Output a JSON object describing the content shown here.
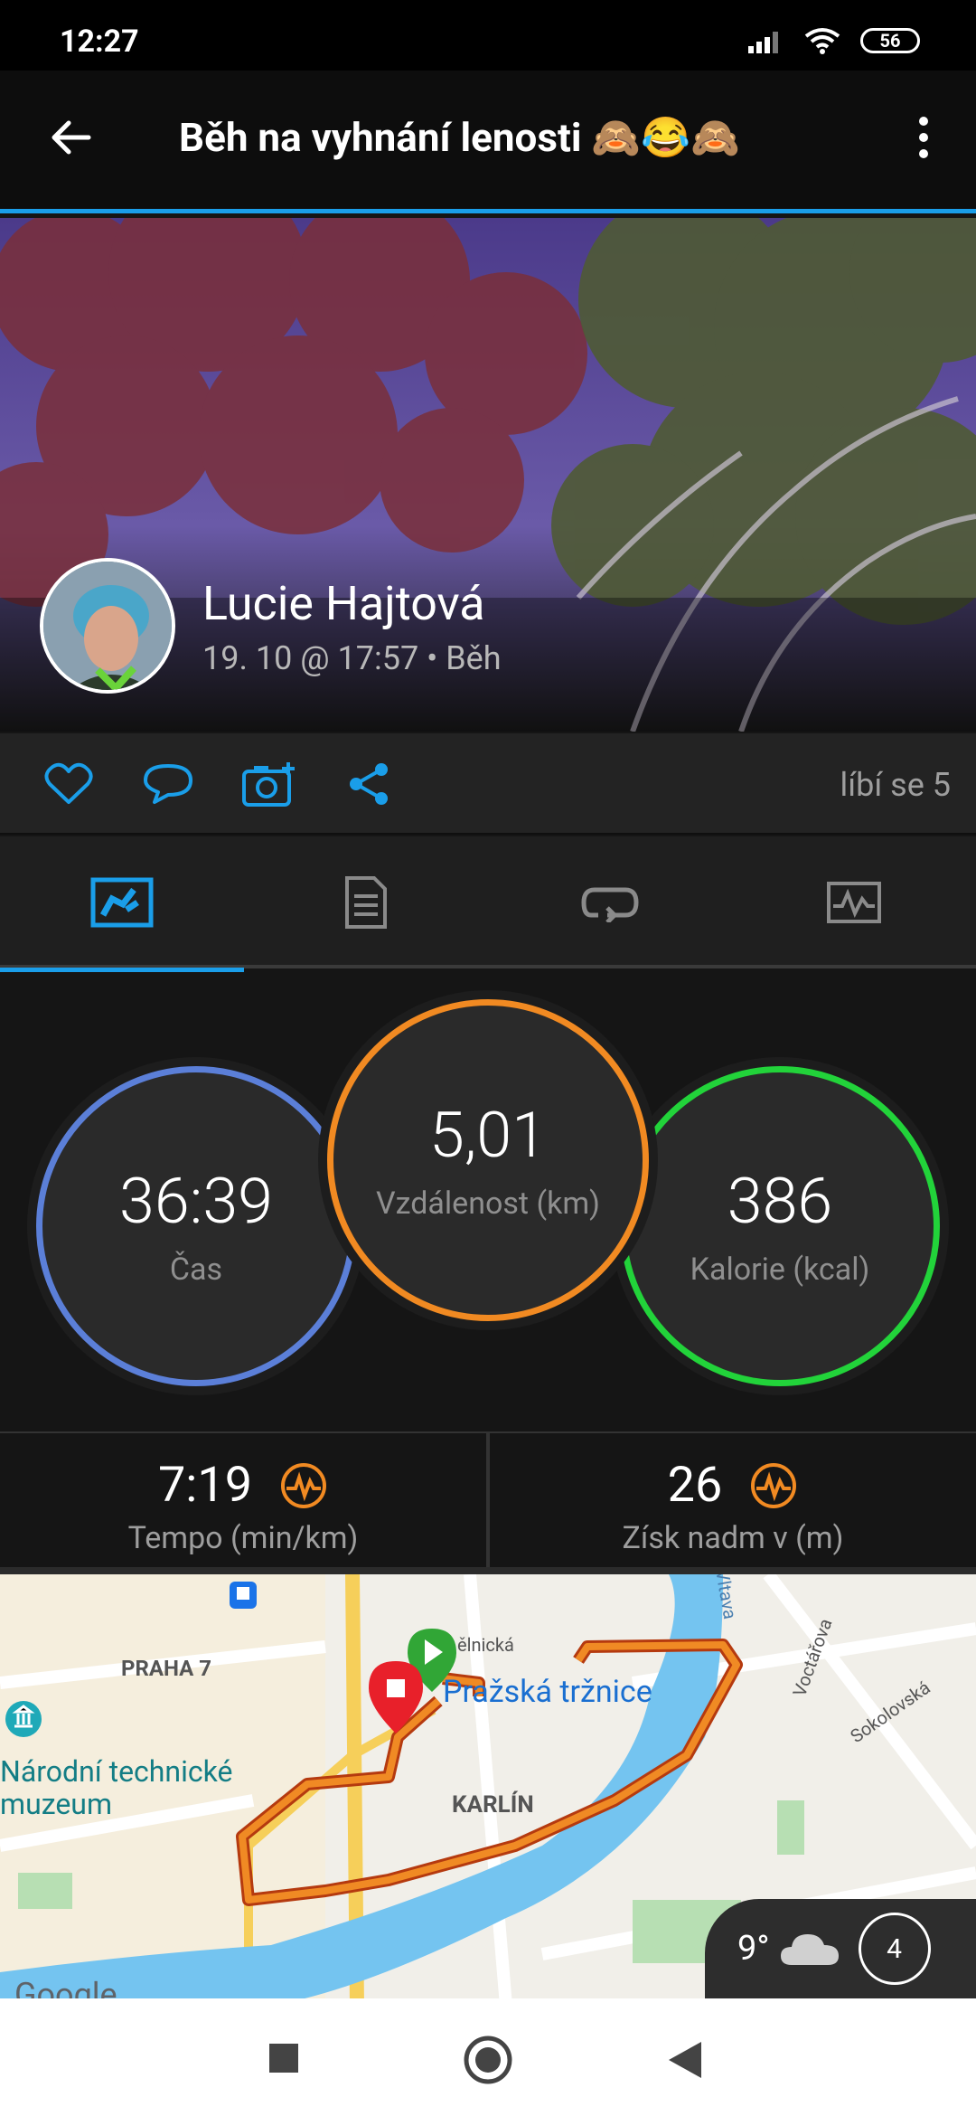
{
  "status": {
    "time": "12:27",
    "battery": "56"
  },
  "header": {
    "title": "Běh na vyhnání lenosti 🙈😂🙈"
  },
  "activity": {
    "user": "Lucie Hajtová",
    "meta": "19. 10 @ 17:57 • Běh"
  },
  "social": {
    "likes": "líbí se 5"
  },
  "stats": {
    "time": {
      "value": "36:39",
      "label": "Čas"
    },
    "distance": {
      "value": "5,01",
      "label": "Vzdálenost (km)"
    },
    "calories": {
      "value": "386",
      "label": "Kalorie (kcal)"
    }
  },
  "metrics": {
    "pace": {
      "value": "7:19",
      "label": "Tempo (min/km)"
    },
    "elevation": {
      "value": "26",
      "label": "Získ nadm v (m)"
    }
  },
  "map": {
    "labels": {
      "praha7": "PRAHA 7",
      "market": "Pražská tržnice",
      "street1": "ělnická",
      "museum": "Národní technické muzeum",
      "karlin": "KARLÍN",
      "vltava": "Vltava",
      "voctarova": "Voctářova",
      "sokolovska": "Sokolovská",
      "google": "Google"
    },
    "weather": {
      "temp": "9°",
      "count": "4"
    }
  },
  "colors": {
    "accent": "#1a9ee9",
    "time_ring": "#4a8fe0",
    "distance_ring": "#f18a22",
    "calories_ring": "#22d33a",
    "route": "#f08a24"
  }
}
